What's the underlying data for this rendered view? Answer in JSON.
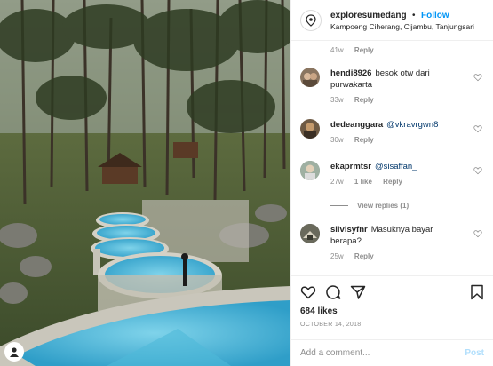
{
  "header": {
    "username": "exploresumedang",
    "dot": "•",
    "follow_label": "Follow",
    "location": "Kampoeng Ciherang, Cijambu, Tanjungsari"
  },
  "top_meta": {
    "time": "41w",
    "reply": "Reply"
  },
  "comments": [
    {
      "user": "hendi8926",
      "text": "besok otw dari purwakarta",
      "mention": "",
      "time": "33w",
      "likes": "",
      "reply": "Reply"
    },
    {
      "user": "dedeanggara",
      "text": "",
      "mention": "@vkravrgwn8",
      "time": "30w",
      "likes": "",
      "reply": "Reply"
    },
    {
      "user": "ekaprmtsr",
      "text": "",
      "mention": "@sisaffan_",
      "time": "27w",
      "likes": "1 like",
      "reply": "Reply"
    },
    {
      "user": "silvisyfnr",
      "text": "Masuknya bayar berapa?",
      "mention": "",
      "time": "25w",
      "likes": "",
      "reply": "Reply"
    }
  ],
  "view_replies": "View replies (1)",
  "actions": {
    "like_icon": "heart-icon",
    "comment_icon": "comment-icon",
    "share_icon": "share-icon",
    "save_icon": "bookmark-icon",
    "likes": "684 likes",
    "date": "OCTOBER 14, 2018"
  },
  "add_comment": {
    "placeholder": "Add a comment...",
    "post_label": "Post"
  },
  "colors": {
    "link": "#0095f6",
    "mention": "#00376b",
    "muted": "#8e8e8e",
    "text": "#262626"
  }
}
